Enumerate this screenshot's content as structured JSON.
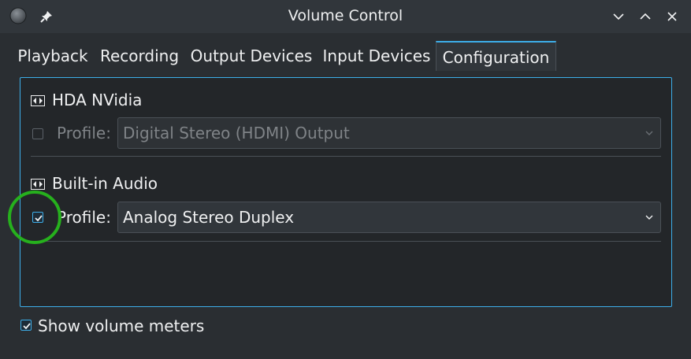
{
  "window": {
    "title": "Volume Control"
  },
  "tabs": [
    {
      "label": "Playback"
    },
    {
      "label": "Recording"
    },
    {
      "label": "Output Devices"
    },
    {
      "label": "Input Devices"
    },
    {
      "label": "Configuration",
      "active": true
    }
  ],
  "cards": [
    {
      "name": "HDA NVidia",
      "profile_label": "Profile:",
      "profile_value": "Digital Stereo (HDMI) Output",
      "checked": false,
      "disabled": true
    },
    {
      "name": "Built-in Audio",
      "profile_label": "Profile:",
      "profile_value": "Analog Stereo Duplex",
      "checked": true,
      "disabled": false
    }
  ],
  "options": {
    "show_volume_meters": "Show volume meters",
    "show_volume_meters_checked": true
  },
  "colors": {
    "accent": "#3daee9",
    "highlight": "#26b01d"
  },
  "icons": [
    "window-menu-icon",
    "pin-icon",
    "minimize-icon",
    "maximize-icon",
    "close-icon",
    "sound-card-icon",
    "checkmark-icon",
    "chevron-down-icon"
  ]
}
